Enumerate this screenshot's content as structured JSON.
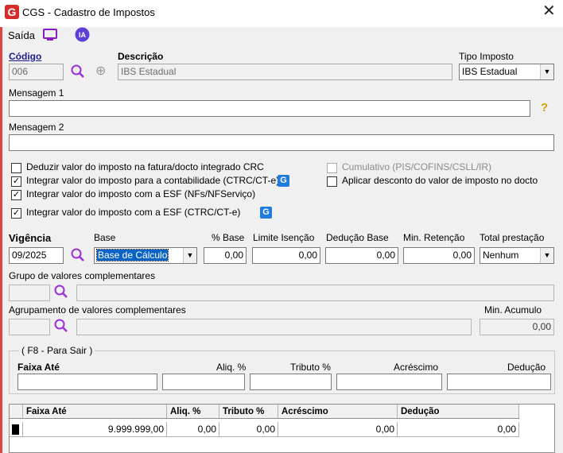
{
  "window": {
    "title": "CGS - Cadastro de Impostos"
  },
  "toolbar": {
    "exit_label": "Saída",
    "ai_label": "IA"
  },
  "codigo": {
    "label": "Código",
    "value": "006"
  },
  "descricao": {
    "label": "Descrição",
    "value": "IBS Estadual"
  },
  "tipo_imposto": {
    "label": "Tipo Imposto",
    "value": "IBS Estadual"
  },
  "mensagem1": {
    "label": "Mensagem 1",
    "value": ""
  },
  "mensagem2": {
    "label": "Mensagem 2",
    "value": ""
  },
  "checks": {
    "deduzir": {
      "label": "Deduzir valor do imposto na fatura/docto integrado CRC",
      "checked": false
    },
    "integrar_contab": {
      "label": "Integrar valor do imposto para a contabilidade (CTRC/CT-e)",
      "checked": true
    },
    "integrar_esf_nfs": {
      "label": "Integrar valor do imposto com a ESF (NFs/NFServiço)",
      "checked": true
    },
    "integrar_esf_ctrc": {
      "label": "Integrar valor do imposto com a ESF (CTRC/CT-e)",
      "checked": true
    },
    "cumulativo": {
      "label": "Cumulativo (PIS/COFINS/CSLL/IR)",
      "checked": false
    },
    "aplicar_desconto": {
      "label": "Aplicar desconto do valor de imposto no docto",
      "checked": false
    }
  },
  "vigencia": {
    "label": "Vigência",
    "value": "09/2025"
  },
  "base": {
    "label": "Base",
    "value": "Base de Cálculo"
  },
  "pct_base": {
    "label": "% Base",
    "value": "0,00"
  },
  "limite_isencao": {
    "label": "Limite Isenção",
    "value": "0,00"
  },
  "deducao_base": {
    "label": "Dedução Base",
    "value": "0,00"
  },
  "min_retencao": {
    "label": "Min. Retenção",
    "value": "0,00"
  },
  "total_prestacao": {
    "label": "Total prestação",
    "value": "Nenhum"
  },
  "grupo_valores": {
    "label": "Grupo de valores complementares"
  },
  "agrupamento_valores": {
    "label": "Agrupamento de valores complementares"
  },
  "min_acumulo": {
    "label": "Min. Acumulo",
    "value": "0,00"
  },
  "faixa_group": {
    "caption": "( F8 - Para Sair )",
    "faixa_label": "Faixa Até",
    "aliq_label": "Aliq. %",
    "tributo_label": "Tributo %",
    "acrescimo_label": "Acréscimo",
    "deducao_label": "Dedução"
  },
  "table": {
    "columns": [
      "Faixa Até",
      "Aliq. %",
      "Tributo %",
      "Acréscimo",
      "Dedução"
    ],
    "rows": [
      {
        "faixa": "9.999.999,00",
        "aliq": "0,00",
        "tributo": "0,00",
        "acrescimo": "0,00",
        "deducao": "0,00"
      }
    ]
  },
  "icons": {
    "app": "cgs-logo-icon",
    "exit": "monitor-icon",
    "ai": "ia-icon",
    "search": "magnifier-icon",
    "add": "plus-icon",
    "help": "question-icon",
    "g": "g-integration-icon"
  },
  "colors": {
    "accent": "#8b1ac8",
    "title_label": "#1b1b8f",
    "help": "#d4a000",
    "g_icon": "#1e7be0"
  }
}
